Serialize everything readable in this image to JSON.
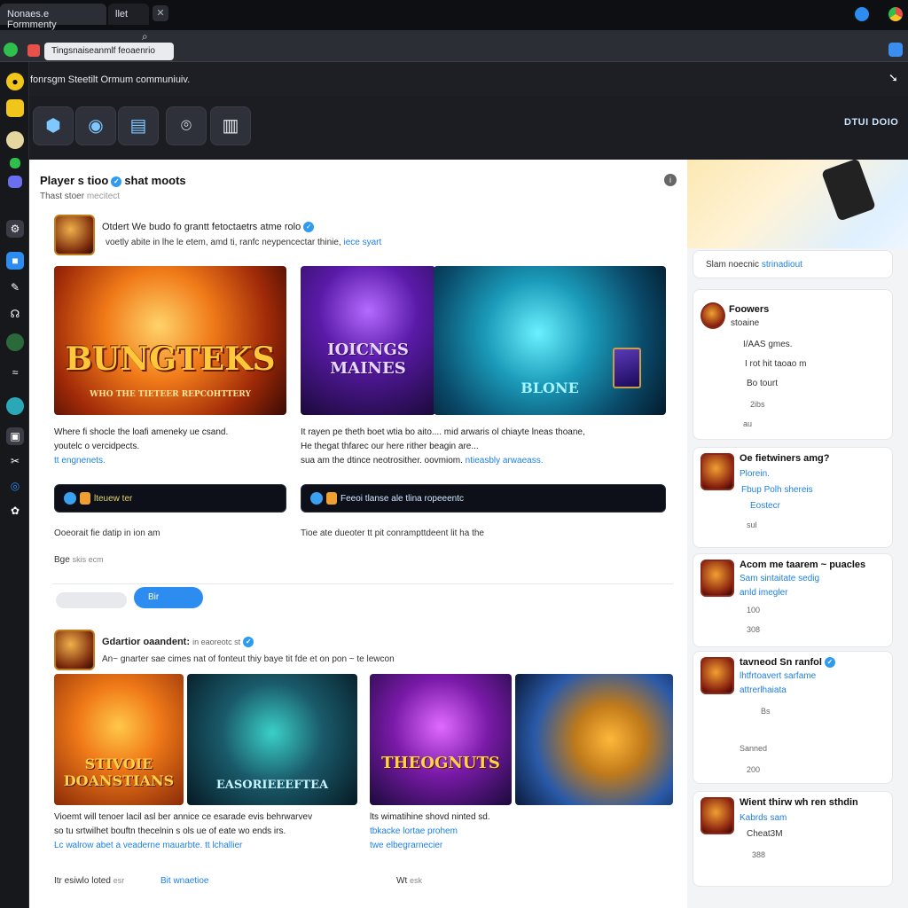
{
  "browser": {
    "tab_active": "Nonaes.e Formmenty",
    "tab_second": "llet",
    "tab_close": "✕",
    "address_text": "Tingsnaiseanmlf feoaenrio",
    "search_glyph": "⌕"
  },
  "header": {
    "community_title": "fonrsgm Steetilt Ormum communiuiv.",
    "brand": "DTUI DOIO"
  },
  "feed": {
    "title": "Player s tioo",
    "title_suffix": "shat moots",
    "subtitle": "Thast stoer",
    "subtitle_suffix": "mecitect",
    "info_glyph": "i",
    "post1": {
      "head": "Otdert We budo fo grantt fetoctaetrs atme rolo",
      "meta": "voetly abite  in lhe le etem, amd ti, ranfc neypencectar thinie,",
      "meta_link": "iece syart",
      "image_left_title": "BUNGTEKS",
      "image_left_sub": "WHO THE TIETEER REPCOHTTERY",
      "image_mid_title": "IOICNGS MAINES",
      "image_right_title": "BLONE",
      "caption_left_1": "Where fi shocle the loafi ameneky ue csand.",
      "caption_left_2": "youtelc o vercidpects.",
      "caption_left_link": "tt engnenets.",
      "caption_right_1": "It rayen pe theth boet wtia bo aito.... mid arwaris ol chiayte lneas thoane,",
      "caption_right_2": "He thegat thfarec our here rither beagin are...",
      "caption_right_3": "sua am the dtince neotrosither. oovmiom.",
      "caption_right_link": "ntieasbly arwaeass.",
      "bar_left_label": "lteuew ter",
      "bar_right_label": "Feeoi tlanse ale tlina ropeeentc",
      "footer_left": "Ooeorait fie datip in ion am",
      "footer_right": "Tioe ate dueoter tt pit conrampttdeent lit ha the",
      "footer_tag": "Bge",
      "footer_tag_meta": "skis ecm",
      "reply_button": "Bir"
    },
    "post2": {
      "head": "Gdartior oaandent:",
      "head_suffix": "in eaoreotc st",
      "meta": "An~ gnarter sae cimes nat of fonteut thiy baye tit fde et on pon ~ te lewcon",
      "img1_title": "STIVOIE DOANSTIANS",
      "img2_title": "EASORIEEEFTEA",
      "img3_title": "THEOGNUTS",
      "caption_left_1": "Vioemt will tenoer lacil asl ber annice ce esarade evis behrwarvev",
      "caption_left_2": "so tu srtwilhet bouftn thecelnin s ols ue of eate wo ends irs.",
      "caption_left_link": "Lc walrow abet a veaderne mauarbte.",
      "caption_left_link2": "tt lchallier",
      "caption_right_1": "lts wimatihine shovd ninted sd.",
      "caption_right_link": "tbkacke lortae prohem",
      "caption_right_link2": "twe elbegrarnecier",
      "footer_left": "Itr esiwlo loted",
      "footer_left_meta": "esr",
      "footer_link": "Bit wnaetioe",
      "footer_right": "Wt",
      "footer_right_meta": "esk"
    }
  },
  "sidebar": {
    "search_card": {
      "label": "Slam noecnic",
      "link": "strinadiout"
    },
    "card1": {
      "title": "Foowers",
      "sub": "stoaine",
      "line1": "I/AAS  gmes.",
      "line2": "I rot hit taoao m",
      "line3": "Bo tourt",
      "count1": "2ibs",
      "count2": "au"
    },
    "card2": {
      "title": "Oe fietwiners amg?",
      "link1": "Plorein.",
      "link2": "Fbup Polh shereis",
      "link3": "Eostecr",
      "count": "sul"
    },
    "card3": {
      "title": "Acom me taarem",
      "title_suffix": "puacles",
      "link1": "Sam sintaitate sedig",
      "link2": "anld imegler",
      "count1": "100",
      "count2": "308"
    },
    "card4": {
      "title": "tavneod Sn ranfol",
      "link1": "lhtfrtoavert sarfame",
      "link2": "attrerlhaiata",
      "count1": "Bs",
      "count2": "Sanned",
      "count3": "200"
    },
    "card5": {
      "title": "Wient thirw wh ren sthdin",
      "link1": "Kabrds sam",
      "line2": "Cheat3M",
      "count": "388"
    }
  }
}
